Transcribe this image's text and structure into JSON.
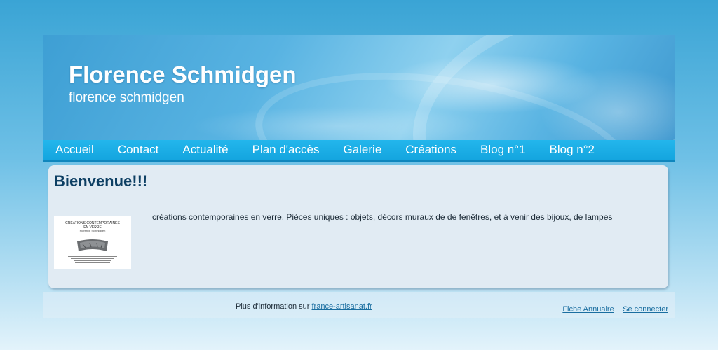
{
  "header": {
    "title": "Florence Schmidgen",
    "subtitle": "florence schmidgen"
  },
  "nav": {
    "items": [
      "Accueil",
      "Contact",
      "Actualité",
      "Plan d'accès",
      "Galerie",
      "Créations",
      "Blog n°1",
      "Blog n°2"
    ]
  },
  "content": {
    "heading": "Bienvenue!!!",
    "thumbnail": {
      "line1": "CREATIONS CONTEMPORAINES",
      "line2": "EN VERRE",
      "line3": "Florence Schmidgen"
    },
    "description": "créations contemporaines en verre. Pièces uniques : objets, décors muraux de de fenêtres, et à venir des bijoux, de lampes"
  },
  "footer": {
    "info_text": "Plus d'information sur ",
    "info_link": "france-artisanat.fr",
    "annuaire_link": "Fiche Annuaire",
    "login_link": "Se connecter"
  },
  "colors": {
    "background": "#3aa4d5",
    "nav": "#14a5df",
    "content_bg": "#e1ebf3",
    "heading": "#0d3f63",
    "link": "#1a6ea0"
  }
}
